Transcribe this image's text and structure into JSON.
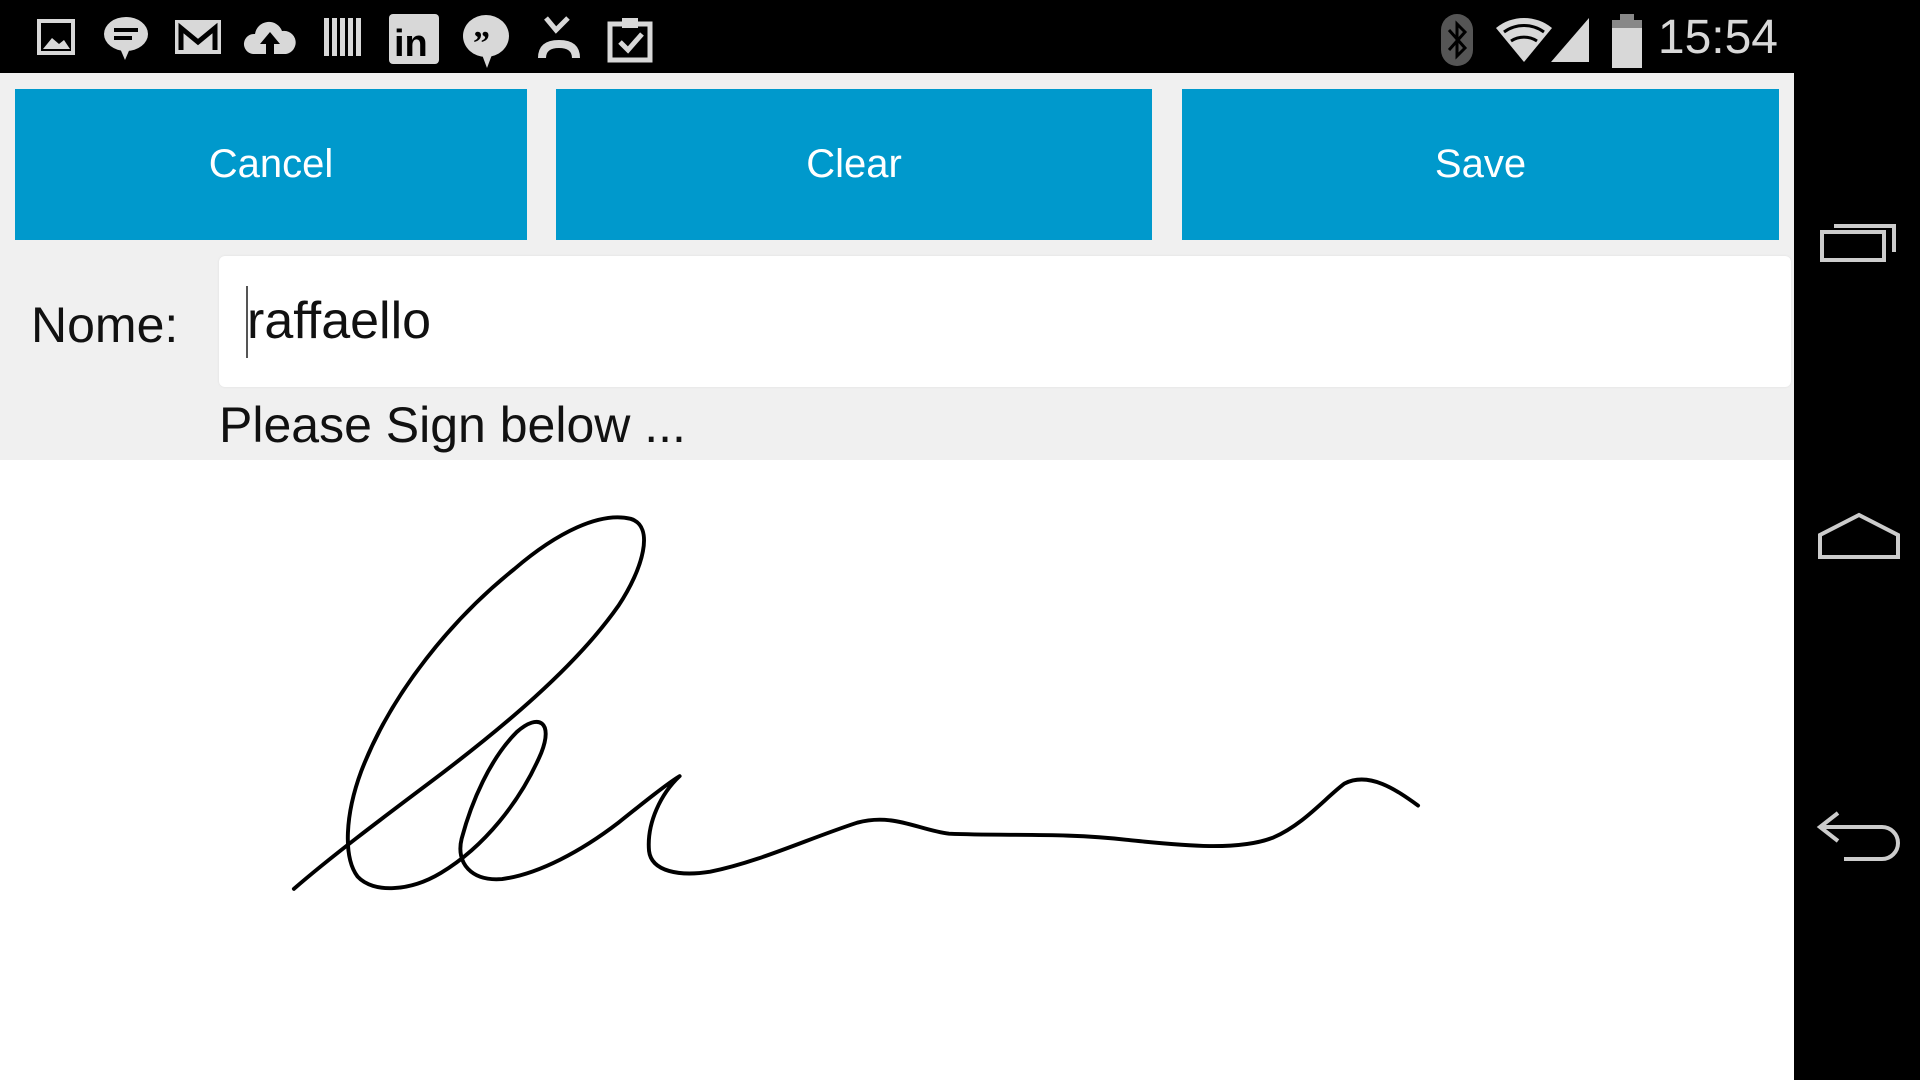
{
  "status_bar": {
    "time": "15:54",
    "left_icons": [
      "gallery-icon",
      "hangouts-message-icon",
      "gmail-icon",
      "cloud-upload-icon",
      "barcode-icon",
      "linkedin-icon",
      "quote-chat-icon",
      "missed-call-icon",
      "clipboard-check-icon"
    ],
    "right_icons": [
      "bluetooth-icon",
      "wifi-icon",
      "signal-icon",
      "battery-icon"
    ]
  },
  "toolbar": {
    "cancel_label": "Cancel",
    "clear_label": "Clear",
    "save_label": "Save",
    "button_color": "#0099cc"
  },
  "form": {
    "name_label": "Nome:",
    "name_value": "raffaello",
    "prompt": "Please Sign below ..."
  },
  "nav_bar": {
    "buttons": [
      "recent-apps",
      "home",
      "back"
    ]
  }
}
